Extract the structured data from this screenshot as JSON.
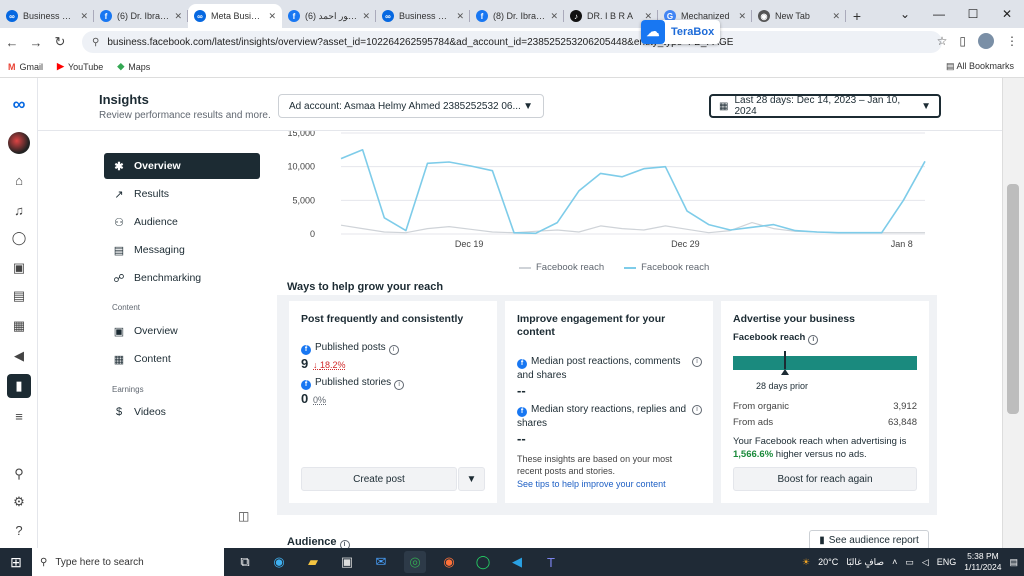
{
  "browser": {
    "tabs": [
      {
        "title": "Business Sett",
        "icon": "meta",
        "color": "#0668e1"
      },
      {
        "title": "(6) Dr. Ibrahim",
        "icon": "facebook",
        "color": "#1877f2"
      },
      {
        "title": "Meta Business",
        "icon": "meta",
        "color": "#0668e1",
        "active": true
      },
      {
        "title": "(6) دكتور احمد",
        "icon": "facebook",
        "color": "#1877f2"
      },
      {
        "title": "Business Sett",
        "icon": "meta",
        "color": "#0668e1"
      },
      {
        "title": "(8) Dr. Ibrahim",
        "icon": "facebook",
        "color": "#1877f2"
      },
      {
        "title": "DR. I B R A",
        "icon": "tiktok",
        "color": "#111111"
      },
      {
        "title": "Mechanized",
        "icon": "google",
        "color": "#4285f4"
      },
      {
        "title": "New Tab",
        "icon": "chrome",
        "color": "#555555"
      }
    ],
    "new_tab": "+",
    "url": "business.facebook.com/latest/insights/overview?asset_id=102264262595784&ad_account_id=238525253206205448&entity_type=FB_PAGE",
    "terabox_label": "TeraBox",
    "bookmarks": [
      "Gmail",
      "YouTube",
      "Maps"
    ],
    "all_bookmarks": "All Bookmarks"
  },
  "header": {
    "title": "Insights",
    "subtitle": "Review performance results and more.",
    "ad_account": "Ad account: Asmaa Helmy Ahmed 2385252532 06...",
    "date_range": "Last 28 days: Dec 14, 2023 – Jan 10, 2024"
  },
  "nav": {
    "items": [
      {
        "label": "Overview",
        "icon": "overview-icon",
        "active": true
      },
      {
        "label": "Results",
        "icon": "results-icon"
      },
      {
        "label": "Audience",
        "icon": "audience-icon"
      },
      {
        "label": "Messaging",
        "icon": "messaging-icon"
      },
      {
        "label": "Benchmarking",
        "icon": "benchmarking-icon"
      }
    ],
    "content_section": "Content",
    "content_items": [
      {
        "label": "Overview",
        "icon": "content-overview-icon"
      },
      {
        "label": "Content",
        "icon": "content-table-icon"
      }
    ],
    "earnings_section": "Earnings",
    "earnings_items": [
      {
        "label": "Videos",
        "icon": "dollar-icon"
      }
    ]
  },
  "chart_data": {
    "type": "line",
    "x_tick_labels": [
      "Dec 19",
      "Dec 29",
      "Jan 8"
    ],
    "x": [
      "Dec 14",
      "Dec 15",
      "Dec 16",
      "Dec 17",
      "Dec 18",
      "Dec 19",
      "Dec 20",
      "Dec 21",
      "Dec 22",
      "Dec 23",
      "Dec 24",
      "Dec 25",
      "Dec 26",
      "Dec 27",
      "Dec 28",
      "Dec 29",
      "Dec 30",
      "Dec 31",
      "Jan 1",
      "Jan 2",
      "Jan 3",
      "Jan 4",
      "Jan 5",
      "Jan 6",
      "Jan 7",
      "Jan 8",
      "Jan 9",
      "Jan 10"
    ],
    "ylim": [
      0,
      15000
    ],
    "y_ticks": [
      0,
      5000,
      10000,
      15000
    ],
    "y_tick_labels": [
      "0",
      "5,000",
      "10,000",
      "15,000"
    ],
    "series": [
      {
        "name": "Facebook reach",
        "color": "#cfd3d8",
        "values": [
          1300,
          800,
          300,
          200,
          800,
          1100,
          700,
          300,
          200,
          400,
          600,
          300,
          1200,
          800,
          600,
          1200,
          700,
          200,
          500,
          1700,
          800,
          400,
          300,
          200,
          200,
          200,
          200,
          200
        ]
      },
      {
        "name": "Facebook reach",
        "color": "#7ecce9",
        "values": [
          11200,
          12500,
          2400,
          500,
          10500,
          10700,
          10100,
          9400,
          200,
          100,
          1700,
          6400,
          9000,
          8500,
          9700,
          10000,
          3400,
          1400,
          600,
          1000,
          1400,
          500,
          300,
          200,
          200,
          200,
          5000,
          10800
        ]
      }
    ],
    "legend_position": "bottom"
  },
  "ways": {
    "title": "Ways to help grow your reach",
    "card1": {
      "title": "Post frequently and consistently",
      "published_posts_label": "Published posts",
      "published_posts_value": "9",
      "published_posts_change": "18.2%",
      "published_stories_label": "Published stories",
      "published_stories_value": "0",
      "published_stories_change": "0%",
      "button": "Create post"
    },
    "card2": {
      "title": "Improve engagement for your content",
      "metric1_label": "Median post reactions, comments and shares",
      "metric1_value": "--",
      "metric2_label": "Median story reactions, replies and shares",
      "metric2_value": "--",
      "note": "These insights are based on your most recent posts and stories.",
      "link": "See tips to help improve your content"
    },
    "card3": {
      "title": "Advertise your business",
      "subtitle": "Facebook reach",
      "reach_marker_fraction": 0.28,
      "marker_label": "28 days prior",
      "organic_label": "From organic",
      "organic_value": "3,912",
      "ads_label": "From ads",
      "ads_value": "63,848",
      "summary_prefix": "Your Facebook reach when advertising is",
      "summary_highlight": "1,566.6%",
      "summary_suffix": "higher versus no ads.",
      "bar_color": "#1a8a7e",
      "button": "Boost for reach again"
    }
  },
  "audience": {
    "title": "Audience",
    "button": "See audience report"
  },
  "taskbar": {
    "search_placeholder": "Type here to search",
    "weather": "20°C",
    "weather_text": "صافٍ غالبًا",
    "language": "ENG",
    "time": "5:38 PM",
    "date": "1/11/2024"
  }
}
